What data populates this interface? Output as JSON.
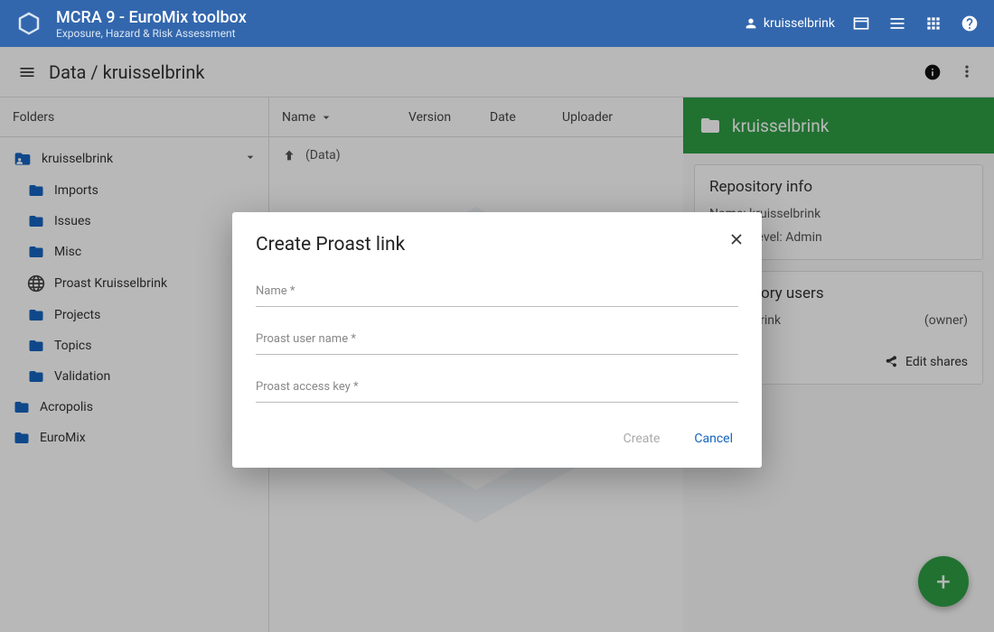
{
  "appbar": {
    "title": "MCRA 9 - EuroMix toolbox",
    "subtitle": "Exposure, Hazard & Risk Assessment",
    "username": "kruisselbrink"
  },
  "breadcrumb": "Data / kruisselbrink",
  "sidebar": {
    "header": "Folders",
    "root": "kruisselbrink",
    "children": [
      {
        "label": "Imports",
        "icon": "folder"
      },
      {
        "label": "Issues",
        "icon": "folder"
      },
      {
        "label": "Misc",
        "icon": "folder"
      },
      {
        "label": "Proast Kruisselbrink",
        "icon": "globe"
      },
      {
        "label": "Projects",
        "icon": "folder"
      },
      {
        "label": "Topics",
        "icon": "folder"
      },
      {
        "label": "Validation",
        "icon": "folder"
      }
    ],
    "siblings": [
      {
        "label": "Acropolis"
      },
      {
        "label": "EuroMix"
      }
    ]
  },
  "columns": {
    "name": "Name",
    "version": "Version",
    "date": "Date",
    "uploader": "Uploader"
  },
  "uprow": "(Data)",
  "rightpanel": {
    "title": "kruisselbrink",
    "info_title": "Repository info",
    "info_name": "Name: kruisselbrink",
    "info_access": "Access level: Admin",
    "users_title": "Repository users",
    "user_name": "kruisselbrink",
    "user_role": "(owner)",
    "edit_shares": "Edit shares"
  },
  "dialog": {
    "title": "Create Proast link",
    "name_label": "Name *",
    "username_label": "Proast user name *",
    "accesskey_label": "Proast access key *",
    "create": "Create",
    "cancel": "Cancel"
  }
}
